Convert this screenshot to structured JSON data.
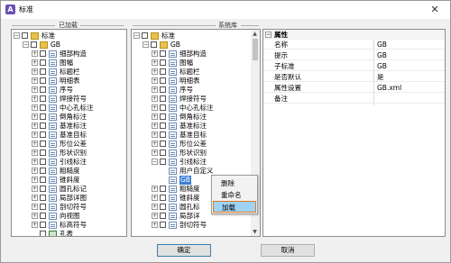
{
  "window": {
    "title": "标准",
    "close_glyph": "✕"
  },
  "sections": {
    "loaded_label": "已加载",
    "library_label": "系统库"
  },
  "left_tree": {
    "root": "标准",
    "std": "GB",
    "items": [
      "细部构造",
      "图幅",
      "标题栏",
      "明细表",
      "序号",
      "焊接符号",
      "中心孔标注",
      "倒角标注",
      "基准标注",
      "基准目标",
      "形位公差",
      "形状识别",
      "引线标注",
      "粗糙度",
      "锥斜度",
      "圆孔标记",
      "局部详图",
      "剖切符号",
      "向视图",
      "标高符号",
      "孔表"
    ]
  },
  "right_tree": {
    "root": "标准",
    "std": "GB",
    "items_top": [
      "细部构造",
      "图幅",
      "标题栏",
      "明细表",
      "序号",
      "焊接符号",
      "中心孔标注",
      "倒角标注",
      "基准标注",
      "基准目标",
      "形位公差",
      "形状识别",
      "引线标注"
    ],
    "sub_items": [
      "用户自定义",
      "GB"
    ],
    "items_bottom": [
      "粗糙度",
      "锥斜度",
      "圆孔标",
      "局部详",
      "剖切符号"
    ]
  },
  "context_menu": {
    "items": [
      "删除",
      "重命名",
      "加载"
    ]
  },
  "properties": {
    "header": "属性",
    "rows": [
      {
        "name": "名称",
        "value": "GB"
      },
      {
        "name": "提示",
        "value": "GB"
      },
      {
        "name": "子标准",
        "value": "GB"
      },
      {
        "name": "是否默认",
        "value": "是"
      },
      {
        "name": "属性设置",
        "value": "GB.xml"
      },
      {
        "name": "备注",
        "value": ""
      }
    ]
  },
  "buttons": {
    "ok": "确定",
    "cancel": "取消"
  }
}
